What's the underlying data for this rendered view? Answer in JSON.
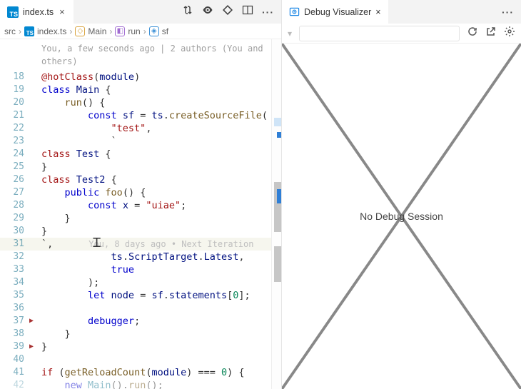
{
  "left_tabs": {
    "file_icon": "TS",
    "filename": "index.ts"
  },
  "right_pane": {
    "tab_icon": "eye",
    "tab_title": "Debug Visualizer",
    "placeholder": "No Debug Session"
  },
  "breadcrumbs": {
    "root": "src",
    "file": "index.ts",
    "sym1": "Main",
    "sym2": "run",
    "sym3": "sf"
  },
  "blame_header": "You, a few seconds ago | 2 authors (You and others)",
  "blame_inline": "You, 8 days ago • Next Iteration",
  "lines": {
    "18": "18",
    "19": "19",
    "20": "20",
    "21": "21",
    "22": "22",
    "23": "23",
    "24": "24",
    "25": "25",
    "26": "26",
    "27": "27",
    "28": "28",
    "29": "29",
    "30": "30",
    "31": "31",
    "32": "32",
    "33": "33",
    "34": "34",
    "35": "35",
    "36": "36",
    "37": "37",
    "38": "38",
    "39": "39",
    "40": "40",
    "41": "41",
    "42": "42"
  },
  "code": {
    "l18a": "@hotClass",
    "l18b": "(",
    "l18c": "module",
    "l18d": ")",
    "l19a": "class ",
    "l19b": "Main ",
    "l19c": "{",
    "l20a": "    ",
    "l20b": "run",
    "l20c": "() {",
    "l21a": "        ",
    "l21b": "const ",
    "l21c": "sf ",
    "l21d": "= ",
    "l21e": "ts",
    "l21f": ".",
    "l21g": "createSourceFile",
    "l21h": "(",
    "l22a": "            ",
    "l22b": "\"test\"",
    "l22c": ",",
    "l23a": "            `",
    "l24a": "class ",
    "l24b": "Test ",
    "l24c": "{",
    "l25a": "}",
    "l26a": "class ",
    "l26b": "Test2 ",
    "l26c": "{",
    "l27a": "    ",
    "l27b": "public ",
    "l27c": "foo",
    "l27d": "() {",
    "l28a": "        ",
    "l28b": "const ",
    "l28c": "x ",
    "l28d": "= ",
    "l28e": "\"uiae\"",
    "l28f": ";",
    "l29a": "    }",
    "l30a": "}",
    "l31a": "`,",
    "l32a": "            ",
    "l32b": "ts",
    "l32c": ".",
    "l32d": "ScriptTarget",
    "l32e": ".",
    "l32f": "Latest",
    "l32g": ",",
    "l33a": "            ",
    "l33b": "true",
    "l34a": "        );",
    "l35a": "        ",
    "l35b": "let ",
    "l35c": "node ",
    "l35d": "= ",
    "l35e": "sf",
    "l35f": ".",
    "l35g": "statements",
    "l35h": "[",
    "l35i": "0",
    "l35j": "];",
    "l36a": "",
    "l37a": "        ",
    "l37b": "debugger",
    "l37c": ";",
    "l38a": "    }",
    "l39a": "}",
    "l40a": "",
    "l41a": "if ",
    "l41b": "(",
    "l41c": "getReloadCount",
    "l41d": "(",
    "l41e": "module",
    "l41f": ") === ",
    "l41g": "0",
    "l41h": ") {",
    "l42a": "    ",
    "l42b": "new ",
    "l42c": "Main",
    "l42d": "().",
    "l42e": "run",
    "l42f": "();"
  }
}
